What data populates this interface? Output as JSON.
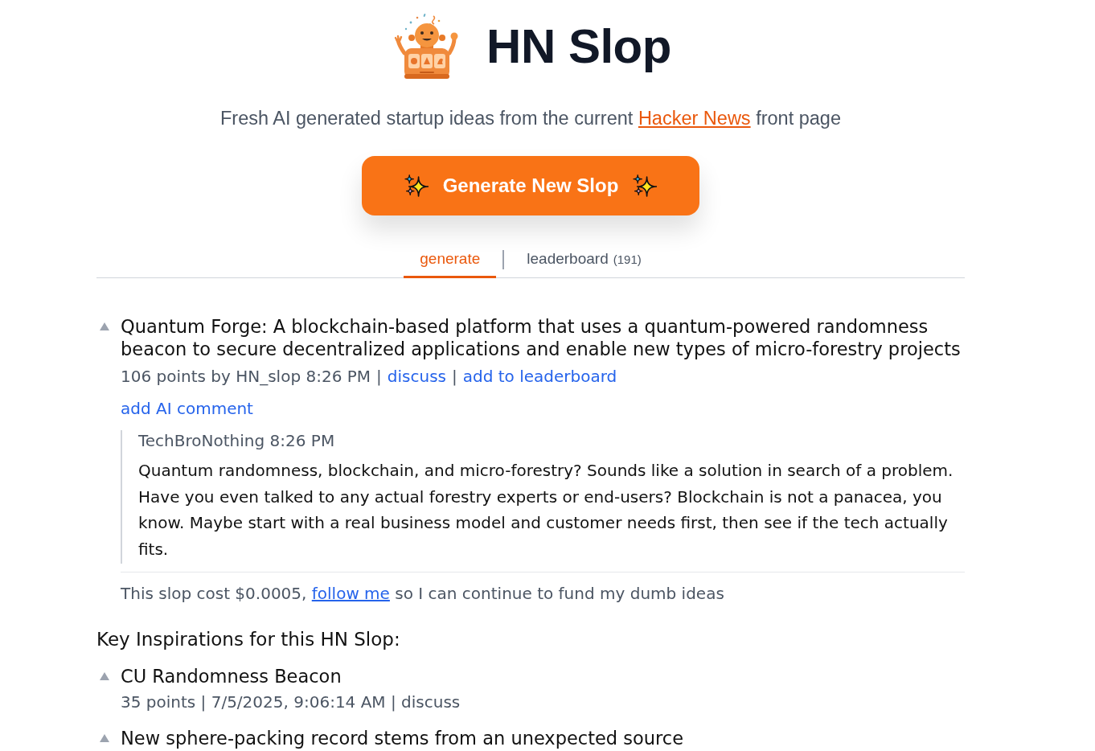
{
  "header": {
    "title": "HN Slop",
    "subtitle": {
      "before": "Fresh AI generated startup ideas from the current",
      "link": "Hacker News",
      "after": "front page"
    }
  },
  "generate_button": {
    "label": "Generate New Slop"
  },
  "tabs": [
    {
      "label": "generate",
      "selected": true
    },
    {
      "label": "leaderboard",
      "count": "(191)",
      "selected": false
    }
  ],
  "idea": {
    "title": "Quantum Forge: A blockchain-based platform that uses a quantum-powered randomness beacon to secure decentralized applications and enable new types of micro-forestry projects",
    "byline": "106 points by HN_slop 8:26 PM",
    "separator": "|",
    "links": [
      "discuss",
      "add to leaderboard"
    ],
    "add_comment": "add AI comment",
    "comments": [
      {
        "author": "TechBroNothing",
        "time": "8:26 PM",
        "text": "Quantum randomness, blockchain, and micro-forestry? Sounds like a solution in search of a problem. Have you even talked to any actual forestry experts or end-users? Blockchain is not a panacea, you know. Maybe start with a real business model and customer needs first, then see if the tech actually fits."
      }
    ],
    "cost_note": {
      "before": "This slop cost $0.0005,",
      "link": "follow me",
      "after": "so I can continue to fund my dumb ideas"
    }
  },
  "inspirations": {
    "heading": "Key Inspirations for this HN Slop:",
    "items": [
      {
        "title": "CU Randomness Beacon",
        "meta": "35 points | 7/5/2025, 9:06:14 AM | discuss"
      },
      {
        "title": "New sphere-packing record stems from an unexpected source"
      }
    ]
  }
}
